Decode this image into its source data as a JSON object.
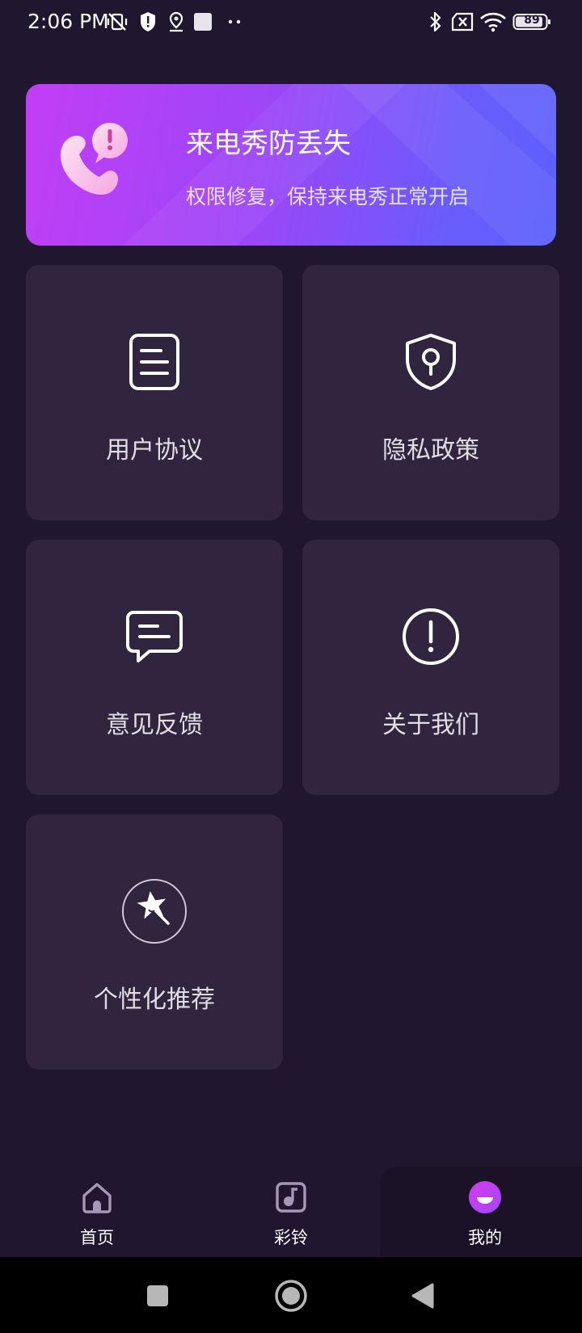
{
  "status_bar": {
    "time": "2:06 PM",
    "battery": "89",
    "icons": [
      "mute-vibrate-icon",
      "shield-alert-icon",
      "location-icon",
      "square-notification-icon",
      "more-dots-icon",
      "bluetooth-icon",
      "no-sim-icon",
      "wifi-icon",
      "battery-icon"
    ]
  },
  "banner": {
    "title": "来电秀防丢失",
    "subtitle": "权限修复，保持来电秀正常开启",
    "icon": "phone-alert-icon",
    "gradient": [
      "#c23ef6",
      "#5a60fd"
    ]
  },
  "menu": [
    {
      "label": "用户协议",
      "icon": "document-icon"
    },
    {
      "label": "隐私政策",
      "icon": "shield-lock-icon"
    },
    {
      "label": "意见反馈",
      "icon": "chat-bubble-icon"
    },
    {
      "label": "关于我们",
      "icon": "info-exclamation-icon"
    },
    {
      "label": "个性化推荐",
      "icon": "star-wand-icon"
    }
  ],
  "bottom_nav": {
    "items": [
      {
        "label": "首页",
        "icon": "home-icon",
        "active": false
      },
      {
        "label": "彩铃",
        "icon": "music-note-icon",
        "active": false
      },
      {
        "label": "我的",
        "icon": "profile-face-icon",
        "active": true
      }
    ]
  },
  "colors": {
    "background": "#21162f",
    "card": "#30243f",
    "accent": "#c23ef6"
  }
}
